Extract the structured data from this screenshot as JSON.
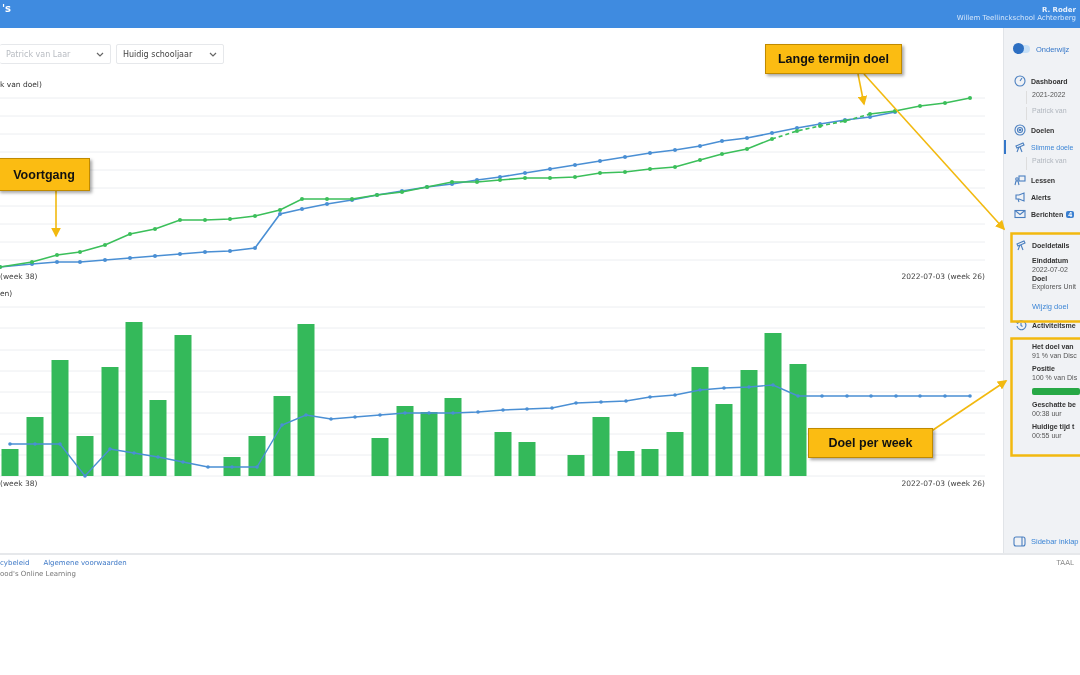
{
  "header": {
    "logo": "'s",
    "user_name": "R. Roder",
    "school": "Willem Teellinckschool Achterberg"
  },
  "filters": [
    {
      "value": "Patrick van Laar",
      "muted": true
    },
    {
      "value": "Huidig schooljaar",
      "muted": false
    }
  ],
  "progress_chart": {
    "title": "k van doel)",
    "start_label": "(week 38)",
    "end_label": "2022-07-03 (week 26)"
  },
  "weekly_chart": {
    "title": "en)",
    "start_label": "(week 38)",
    "end_label": "2022-07-03 (week 26)"
  },
  "sidebar": {
    "toggle": {
      "on": false,
      "label": "Onderwijz"
    },
    "nav": [
      {
        "label": "Dashboard",
        "selected": false,
        "children": [
          {
            "label": "2021-2022",
            "muted": false
          },
          {
            "label": "Patrick van",
            "muted": true
          }
        ]
      },
      {
        "label": "Doelen",
        "selected": false
      },
      {
        "label": "Slimme doele",
        "selected": true,
        "children": [
          {
            "label": "Patrick van",
            "muted": true
          }
        ]
      },
      {
        "label": "Lessen",
        "selected": false
      },
      {
        "label": "Alerts",
        "selected": false
      },
      {
        "label": "Berichten",
        "selected": false,
        "badge": "4"
      }
    ],
    "details": {
      "title": "Doeldetails",
      "fields": [
        {
          "label": "Einddatum",
          "value": "2022-07-02"
        },
        {
          "label": "Doel",
          "value": "Explorers Unit"
        }
      ],
      "link": "Wijzig doel"
    },
    "activity": {
      "title": "Activiteitsme",
      "fields": [
        {
          "label": "Het doel van",
          "value": "91 % van Disc"
        },
        {
          "label": "Positie",
          "value": "100 % van Dis",
          "level": 1
        },
        {
          "label": "Geschatte be",
          "value": "00:38 uur"
        },
        {
          "label": "Huidige tijd t",
          "value": "00:55 uur"
        }
      ]
    },
    "collapse": "Sidebar inklap"
  },
  "footer": {
    "links": [
      "cybeleid",
      "Algemene voorwaarden"
    ],
    "copyright": "ood's Online Learning",
    "language": "TAAL"
  },
  "annotations": [
    {
      "text": "Voortgang"
    },
    {
      "text": "Lange termijn doel"
    },
    {
      "text": "Doel per week"
    }
  ]
}
